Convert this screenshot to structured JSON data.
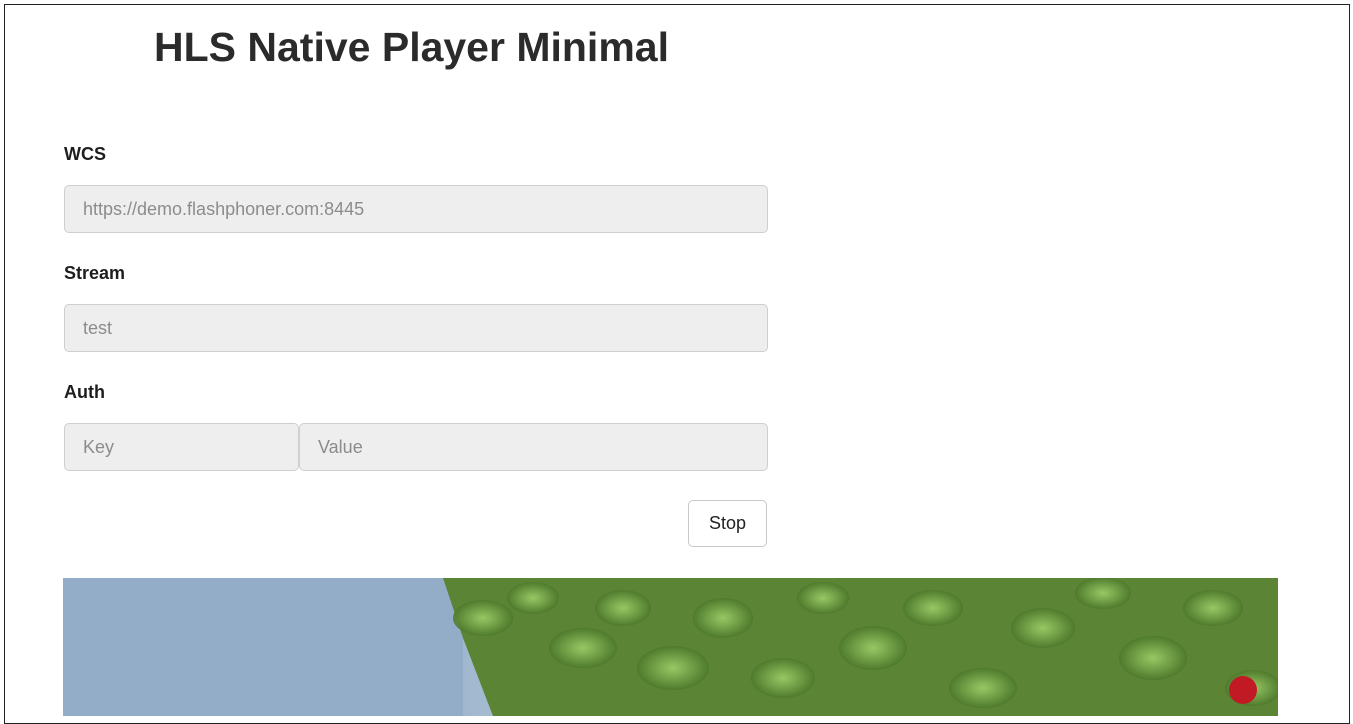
{
  "page": {
    "title": "HLS Native Player Minimal"
  },
  "form": {
    "wcs": {
      "label": "WCS",
      "value": "https://demo.flashphoner.com:8445"
    },
    "stream": {
      "label": "Stream",
      "value": "test"
    },
    "auth": {
      "label": "Auth",
      "key_placeholder": "Key",
      "value_placeholder": "Value"
    },
    "stop_button": "Stop"
  },
  "colors": {
    "field_bg": "#eeeeee",
    "field_border": "#cfcfcf",
    "sky": "#9bb3cc",
    "foliage": "#5f8a35"
  }
}
